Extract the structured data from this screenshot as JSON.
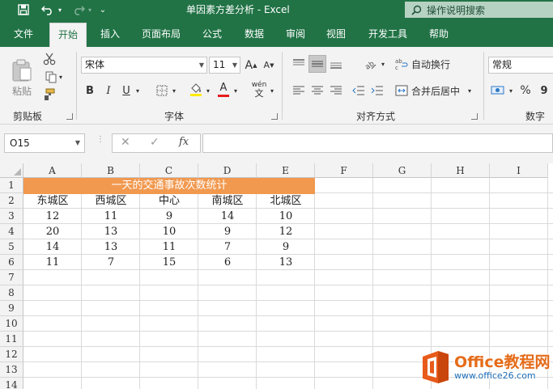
{
  "window": {
    "title": "单因素方差分析  -  Excel",
    "search_placeholder": "操作说明搜索"
  },
  "tabs": [
    "文件",
    "开始",
    "插入",
    "页面布局",
    "公式",
    "数据",
    "审阅",
    "视图",
    "开发工具",
    "帮助"
  ],
  "active_tab": "开始",
  "ribbon": {
    "clipboard": {
      "paste_label": "粘贴",
      "group_label": "剪贴板"
    },
    "font": {
      "font_name": "宋体",
      "font_size": "11",
      "bold": "B",
      "italic": "I",
      "underline": "U",
      "grow": "A",
      "shrink": "A",
      "pinyin": "wén",
      "font_color_glyph": "A",
      "group_label": "字体"
    },
    "alignment": {
      "wrap_text": "自动换行",
      "merge_center": "合并后居中",
      "group_label": "对齐方式"
    },
    "number": {
      "format": "常规",
      "percent": "%",
      "comma": "9",
      "group_label": "数字"
    }
  },
  "formula_bar": {
    "name_box": "O15",
    "fx": "fx",
    "cancel": "✕",
    "confirm": "✓",
    "value": ""
  },
  "sheet": {
    "columns": [
      "A",
      "B",
      "C",
      "D",
      "E",
      "F",
      "G",
      "H",
      "I"
    ],
    "rows": [
      "1",
      "2",
      "3",
      "4",
      "5",
      "6",
      "7",
      "8",
      "9",
      "10",
      "11",
      "12",
      "13",
      "14"
    ],
    "merged_title": "一天的交通事故次数统计",
    "headers": [
      "东城区",
      "西城区",
      "中心",
      "南城区",
      "北城区"
    ],
    "data": [
      [
        "12",
        "11",
        "9",
        "14",
        "10"
      ],
      [
        "20",
        "13",
        "10",
        "9",
        "12"
      ],
      [
        "14",
        "13",
        "11",
        "7",
        "9"
      ],
      [
        "11",
        "7",
        "15",
        "6",
        "13"
      ]
    ],
    "title_fill": "#F1994F"
  },
  "watermark": {
    "brand": "Office教程网",
    "url": "www.office26.com"
  },
  "colors": {
    "excel_green": "#217346",
    "ribbon_bg": "#F3F3F3"
  }
}
